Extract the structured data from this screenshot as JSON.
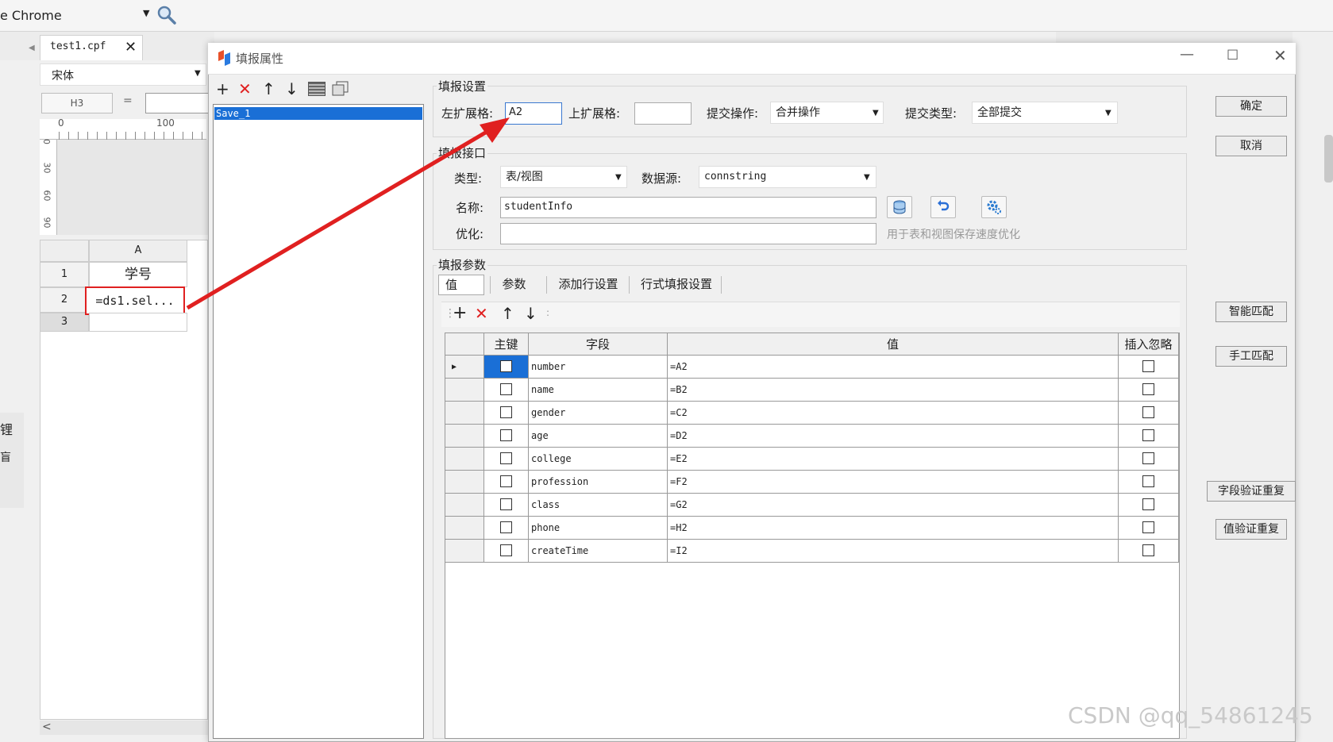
{
  "app": {
    "name": "e Chrome",
    "file_tab": "test1.cpf",
    "font_name": "宋体",
    "cell_ref": "H3",
    "ruler": {
      "h0": "0",
      "h100": "100",
      "v0": "0",
      "v30": "30",
      "v60": "60",
      "v90": "90"
    },
    "sheet": {
      "col_a": "A",
      "rows": [
        "1",
        "2",
        "3"
      ],
      "a1": "学号",
      "a2": "=ds1.sel..."
    },
    "left_edge_chars": [
      "锂",
      "盲"
    ]
  },
  "dialog": {
    "title": "填报属性",
    "list_items": [
      "Save_1"
    ],
    "report_settings": {
      "title": "填报设置",
      "left_expand_label": "左扩展格:",
      "left_expand_value": "A2",
      "top_expand_label": "上扩展格:",
      "top_expand_value": "",
      "submit_op_label": "提交操作:",
      "submit_op_value": "合并操作",
      "submit_type_label": "提交类型:",
      "submit_type_value": "全部提交"
    },
    "interface": {
      "title": "填报接口",
      "type_label": "类型:",
      "type_value": "表/视图",
      "datasource_label": "数据源:",
      "datasource_value": "connstring",
      "name_label": "名称:",
      "name_value": "studentInfo",
      "optimize_label": "优化:",
      "optimize_value": "",
      "optimize_hint": "用于表和视图保存速度优化"
    },
    "params": {
      "title": "填报参数",
      "tabs": [
        "值",
        "参数",
        "添加行设置",
        "行式填报设置"
      ],
      "columns": [
        "主键",
        "字段",
        "值",
        "插入忽略"
      ],
      "rows": [
        {
          "field": "number",
          "value": "=A2"
        },
        {
          "field": "name",
          "value": "=B2"
        },
        {
          "field": "gender",
          "value": "=C2"
        },
        {
          "field": "age",
          "value": "=D2"
        },
        {
          "field": "college",
          "value": "=E2"
        },
        {
          "field": "profession",
          "value": "=F2"
        },
        {
          "field": "class",
          "value": "=G2"
        },
        {
          "field": "phone",
          "value": "=H2"
        },
        {
          "field": "createTime",
          "value": "=I2"
        }
      ]
    },
    "buttons": {
      "ok": "确定",
      "cancel": "取消",
      "smart_match": "智能匹配",
      "manual_match": "手工匹配",
      "field_dup_check": "字段验证重复",
      "value_dup_check": "值验证重复"
    }
  },
  "watermark": "CSDN @qq_54861245",
  "colors": {
    "selection": "#1a6fd6",
    "annotation_red": "#e02020",
    "delete_red": "#e02020"
  }
}
